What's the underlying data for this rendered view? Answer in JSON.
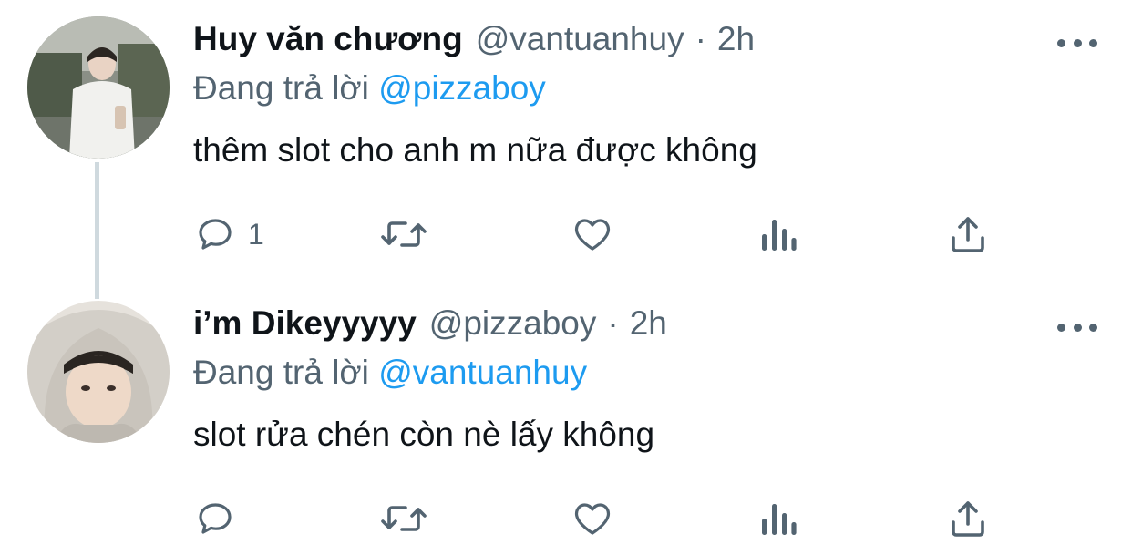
{
  "thread": {
    "tweets": [
      {
        "display_name": "Huy văn chương",
        "handle": "@vantuanhuy",
        "separator": "·",
        "time": "2h",
        "reply_prefix": "Đang trả lời",
        "reply_to": "@pizzaboy",
        "text": "thêm slot cho anh m nữa được không",
        "reply_count": "1",
        "avatar_icon": "avatar-photo",
        "more_icon": "more-dots-icon"
      },
      {
        "display_name": "i’m Dikeyyyyy",
        "handle": "@pizzaboy",
        "separator": "·",
        "time": "2h",
        "reply_prefix": "Đang trả lời",
        "reply_to": "@vantuanhuy",
        "text": "slot rửa chén còn nè lấy không",
        "reply_count": "",
        "avatar_icon": "avatar-photo",
        "more_icon": "more-dots-icon"
      }
    ]
  },
  "colors": {
    "text_primary": "#0f1419",
    "text_secondary": "#536471",
    "link": "#1d9bf0",
    "thread_line": "#cfd9de"
  },
  "action_icons": [
    "reply-icon",
    "retweet-icon",
    "like-icon",
    "views-icon",
    "share-icon"
  ]
}
